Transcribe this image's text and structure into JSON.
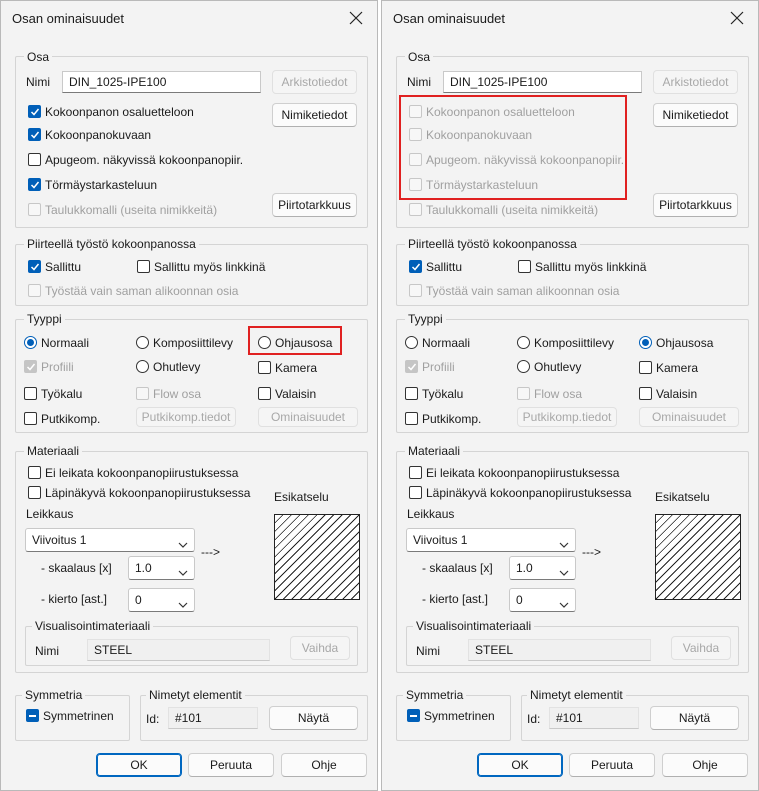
{
  "dialogs": [
    {
      "title": "Osan ominaisuudet",
      "osa": {
        "group_label": "Osa",
        "nimi_label": "Nimi",
        "nimi_value": "DIN_1025-IPE100",
        "arkistotiedot_label": "Arkistotiedot",
        "nimiketiedot_label": "Nimiketiedot",
        "piirtotarkkuus_label": "Piirtotarkkuus",
        "checks": [
          {
            "label": "Kokoonpanon osaluetteloon",
            "state": "checked"
          },
          {
            "label": "Kokoonpanokuvaan",
            "state": "checked"
          },
          {
            "label": "Apugeom. näkyvissä kokoonpanopiir.",
            "state": "unchecked"
          },
          {
            "label": "Törmäystarkasteluun",
            "state": "checked"
          },
          {
            "label": "Taulukkomalli (useita nimikkeitä)",
            "state": "disabled"
          }
        ]
      },
      "tyosto": {
        "group_label": "Piirteellä työstö kokoonpanossa",
        "sallittu": "Sallittu",
        "linkki": "Sallittu myös linkkinä",
        "alikoonnan": "Työstää vain saman alikoonnan osia"
      },
      "tyyppi": {
        "group_label": "Tyyppi",
        "normaali": "Normaali",
        "profiili": "Profiili",
        "tyokalu": "Työkalu",
        "putkikomp": "Putkikomp.",
        "komposiittilevy": "Komposiittilevy",
        "ohutlevy": "Ohutlevy",
        "flow_osa": "Flow osa",
        "putkikomp_tiedot": "Putkikomp.tiedot",
        "ohjausosa": "Ohjausosa",
        "kamera": "Kamera",
        "valaisin": "Valaisin",
        "ominaisuudet": "Ominaisuudet",
        "selected": "normaali"
      },
      "materiaali": {
        "group_label": "Materiaali",
        "ei_leikata": "Ei leikata kokoonpanopiirustuksessa",
        "lapinakyva": "Läpinäkyvä kokoonpanopiirustuksessa",
        "esikatselu": "Esikatselu",
        "leikkaus": "Leikkaus",
        "viivoitus": "Viivoitus 1",
        "arrow": "--->",
        "skaalaus_label": "- skaalaus [x]",
        "skaalaus_value": "1.0",
        "kierto_label": "- kierto [ast.]",
        "kierto_value": "0",
        "vis_group_label": "Visualisointimateriaali",
        "vis_nimi_label": "Nimi",
        "vis_nimi_value": "STEEL",
        "vaihda": "Vaihda"
      },
      "symmetria": {
        "group_label": "Symmetria",
        "symmetrinen": "Symmetrinen"
      },
      "nimetyt": {
        "group_label": "Nimetyt elementit",
        "id_label": "Id:",
        "id_value": "#101",
        "nayta": "Näytä"
      },
      "footer": {
        "ok": "OK",
        "peruuta": "Peruuta",
        "ohje": "Ohje"
      }
    },
    {
      "title": "Osan ominaisuudet",
      "osa": {
        "group_label": "Osa",
        "nimi_label": "Nimi",
        "nimi_value": "DIN_1025-IPE100",
        "arkistotiedot_label": "Arkistotiedot",
        "nimiketiedot_label": "Nimiketiedot",
        "piirtotarkkuus_label": "Piirtotarkkuus",
        "checks": [
          {
            "label": "Kokoonpanon osaluetteloon",
            "state": "disabled"
          },
          {
            "label": "Kokoonpanokuvaan",
            "state": "disabled"
          },
          {
            "label": "Apugeom. näkyvissä kokoonpanopiir.",
            "state": "disabled"
          },
          {
            "label": "Törmäystarkasteluun",
            "state": "disabled"
          },
          {
            "label": "Taulukkomalli (useita nimikkeitä)",
            "state": "disabled"
          }
        ]
      },
      "tyosto": {
        "group_label": "Piirteellä työstö kokoonpanossa",
        "sallittu": "Sallittu",
        "linkki": "Sallittu myös linkkinä",
        "alikoonnan": "Työstää vain saman alikoonnan osia"
      },
      "tyyppi": {
        "group_label": "Tyyppi",
        "normaali": "Normaali",
        "profiili": "Profiili",
        "tyokalu": "Työkalu",
        "putkikomp": "Putkikomp.",
        "komposiittilevy": "Komposiittilevy",
        "ohutlevy": "Ohutlevy",
        "flow_osa": "Flow osa",
        "putkikomp_tiedot": "Putkikomp.tiedot",
        "ohjausosa": "Ohjausosa",
        "kamera": "Kamera",
        "valaisin": "Valaisin",
        "ominaisuudet": "Ominaisuudet",
        "selected": "ohjausosa"
      },
      "materiaali": {
        "group_label": "Materiaali",
        "ei_leikata": "Ei leikata kokoonpanopiirustuksessa",
        "lapinakyva": "Läpinäkyvä kokoonpanopiirustuksessa",
        "esikatselu": "Esikatselu",
        "leikkaus": "Leikkaus",
        "viivoitus": "Viivoitus 1",
        "arrow": "--->",
        "skaalaus_label": "- skaalaus [x]",
        "skaalaus_value": "1.0",
        "kierto_label": "- kierto [ast.]",
        "kierto_value": "0",
        "vis_group_label": "Visualisointimateriaali",
        "vis_nimi_label": "Nimi",
        "vis_nimi_value": "STEEL",
        "vaihda": "Vaihda"
      },
      "symmetria": {
        "group_label": "Symmetria",
        "symmetrinen": "Symmetrinen"
      },
      "nimetyt": {
        "group_label": "Nimetyt elementit",
        "id_label": "Id:",
        "id_value": "#101",
        "nayta": "Näytä"
      },
      "footer": {
        "ok": "OK",
        "peruuta": "Peruuta",
        "ohje": "Ohje"
      }
    }
  ],
  "colors": {
    "accent": "#005fb8",
    "highlight": "#e02020",
    "dialog_bg": "#f3f3f3"
  }
}
